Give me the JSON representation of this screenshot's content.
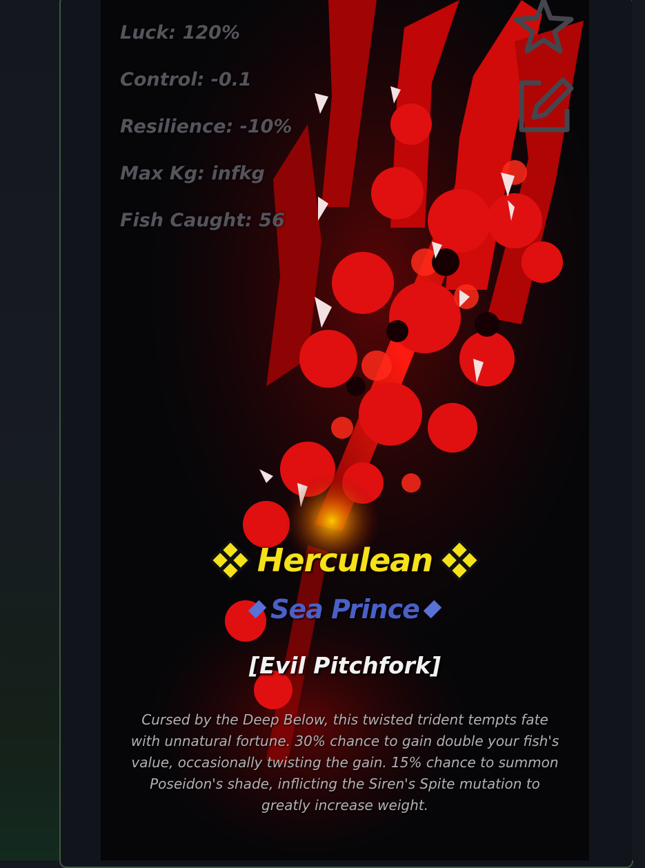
{
  "stats": [
    {
      "label": "Luck: 120%"
    },
    {
      "label": "Control: -0.1"
    },
    {
      "label": "Resilience: -10%"
    },
    {
      "label": "Max Kg: infkg"
    },
    {
      "label": "Fish Caught: 56"
    }
  ],
  "item": {
    "mutation": "Herculean",
    "enchant": "Sea Prince",
    "name": "[Evil Pitchfork]",
    "description": "Cursed by the Deep Below, this twisted trident tempts fate with unnatural fortune. 30% chance to gain double your fish's value, occasionally twisting the gain. 15% chance to summon Poseidon's shade, inflicting the Siren's Spite mutation to greatly increase weight."
  },
  "icons": {
    "favorite": "star-icon",
    "rename": "edit-icon",
    "mutation_badge": "sparkle-diamond-icon",
    "enchant_badge": "diamond-icon"
  },
  "colors": {
    "mutation_text": "#f5e21a",
    "enchant_text": "#4a60c8",
    "name_text": "#f2f2f2",
    "stat_text": "#55545c",
    "art_red": "#d10a0a"
  }
}
